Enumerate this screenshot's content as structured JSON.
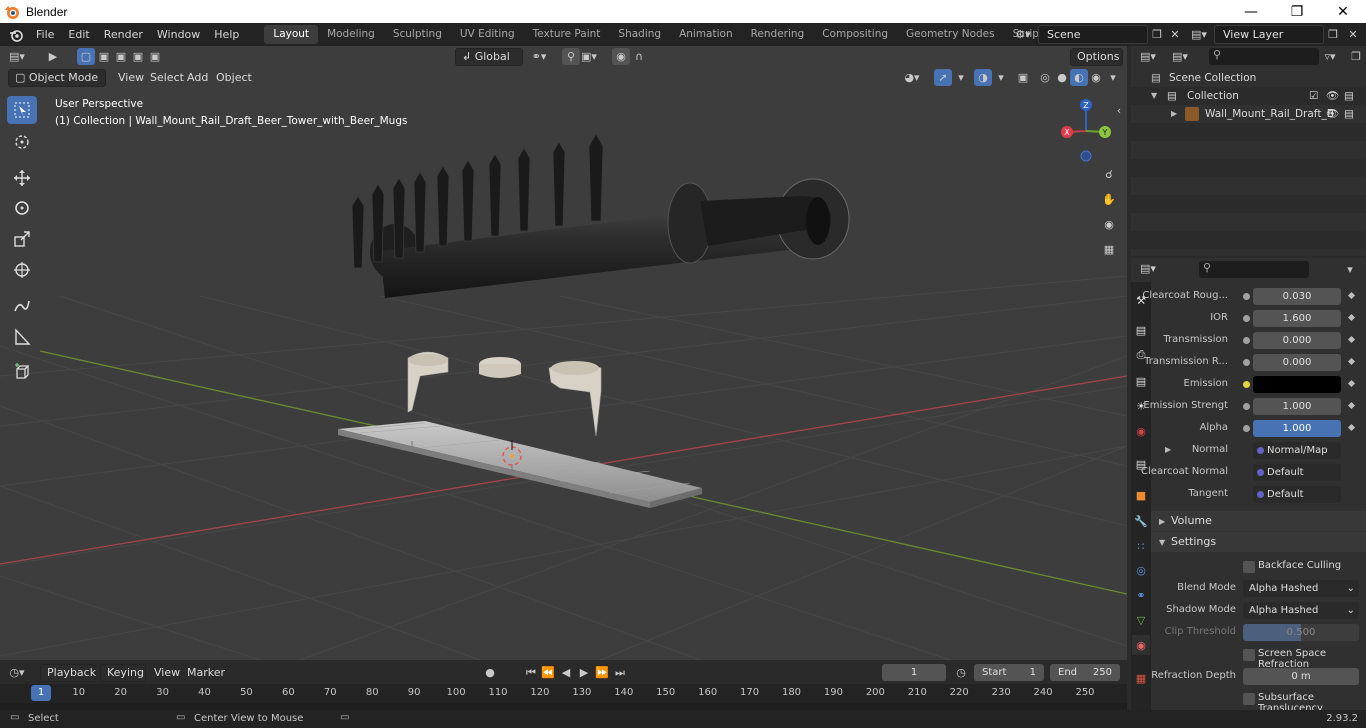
{
  "window": {
    "title": "Blender",
    "controls": [
      "minimize-icon",
      "maximize-icon",
      "close-icon"
    ]
  },
  "menus": [
    "File",
    "Edit",
    "Render",
    "Window",
    "Help"
  ],
  "workspaces": [
    "Layout",
    "Modeling",
    "Sculpting",
    "UV Editing",
    "Texture Paint",
    "Shading",
    "Animation",
    "Rendering",
    "Compositing",
    "Geometry Nodes",
    "Scripting"
  ],
  "active_workspace": "Layout",
  "scene": {
    "name": "Scene",
    "view_layer": "View Layer"
  },
  "viewport_header": {
    "transform_orientation": "Global",
    "options_label": "Options",
    "mode": "Object Mode",
    "menus": [
      "View",
      "Select",
      "Add",
      "Object"
    ]
  },
  "viewport": {
    "perspective_label": "User Perspective",
    "collection_label": "(1) Collection | Wall_Mount_Rail_Draft_Beer_Tower_with_Beer_Mugs",
    "gizmo_axes": [
      "X",
      "Y",
      "Z"
    ]
  },
  "outliner": {
    "root": "Scene Collection",
    "collection": "Collection",
    "object": "Wall_Mount_Rail_Draft_B"
  },
  "properties": {
    "rows": [
      {
        "label": "Clearcoat Roug...",
        "value": "0.030",
        "style": "number"
      },
      {
        "label": "IOR",
        "value": "1.600",
        "style": "number"
      },
      {
        "label": "Transmission",
        "value": "0.000",
        "style": "number"
      },
      {
        "label": "Transmission R...",
        "value": "0.000",
        "style": "number"
      },
      {
        "label": "Emission",
        "value": "",
        "style": "color-black"
      },
      {
        "label": "Emission Strengt",
        "value": "1.000",
        "style": "number"
      },
      {
        "label": "Alpha",
        "value": "1.000",
        "style": "number-blue"
      },
      {
        "label": "Normal",
        "value": "Normal/Map",
        "style": "socket"
      },
      {
        "label": "Clearcoat Normal",
        "value": "Default",
        "style": "socket"
      },
      {
        "label": "Tangent",
        "value": "Default",
        "style": "socket"
      }
    ],
    "sections": {
      "volume": "Volume",
      "settings": "Settings"
    },
    "settings": {
      "backface_culling": "Backface Culling",
      "blend_mode_label": "Blend Mode",
      "blend_mode": "Alpha Hashed",
      "shadow_mode_label": "Shadow Mode",
      "shadow_mode": "Alpha Hashed",
      "clip_threshold_label": "Clip Threshold",
      "clip_threshold": "0.500",
      "screen_space_refraction": "Screen Space Refraction",
      "refraction_depth_label": "Refraction Depth",
      "refraction_depth": "0 m",
      "subsurface_translucency": "Subsurface Translucency"
    }
  },
  "timeline": {
    "menus": [
      "Playback",
      "Keying",
      "View",
      "Marker"
    ],
    "current_frame": "1",
    "start_label": "Start",
    "start": "1",
    "end_label": "End",
    "end": "250",
    "ticks": [
      "1",
      "10",
      "20",
      "30",
      "40",
      "50",
      "60",
      "70",
      "80",
      "90",
      "100",
      "110",
      "120",
      "130",
      "140",
      "150",
      "160",
      "170",
      "180",
      "190",
      "200",
      "210",
      "220",
      "230",
      "240",
      "250"
    ]
  },
  "statusbar": {
    "select": "Select",
    "center_view": "Center View to Mouse",
    "version": "2.93.2"
  },
  "colors": {
    "accent_blue": "#4772b3",
    "viewport_bg": "#3d3d3d",
    "header_bg": "#232323"
  }
}
